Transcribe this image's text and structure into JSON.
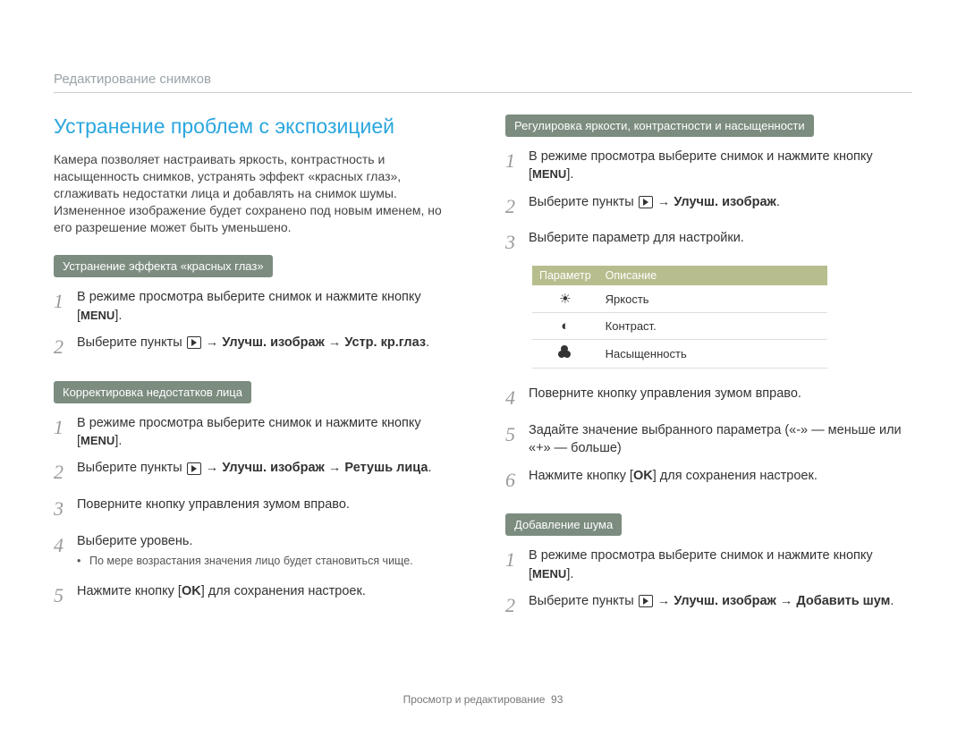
{
  "breadcrumb": "Редактирование снимков",
  "title": "Устранение проблем с экспозицией",
  "intro": "Камера позволяет настраивать яркость, контрастность и насыщенность снимков, устранять эффект «красных глаз», сглаживать недостатки лица и добавлять на снимок шумы. Измененное изображение будет сохранено под новым именем, но его разрешение может быть уменьшено.",
  "sections": {
    "redeye": {
      "badge": "Устранение эффекта «красных глаз»",
      "step1_prefix": "В режиме просмотра выберите снимок и нажмите кнопку [",
      "step1_btn": "MENU",
      "step1_suffix": "].",
      "step2_prefix": "Выберите пункты ",
      "step2_arrow1": " → ",
      "step2_opt1": "Улучш. изображ",
      "step2_arrow2": " → ",
      "step2_opt2": "Устр. кр.глаз",
      "step2_suffix": "."
    },
    "face": {
      "badge": "Корректировка недостатков лица",
      "step1_prefix": "В режиме просмотра выберите снимок и нажмите кнопку [",
      "step1_btn": "MENU",
      "step1_suffix": "].",
      "step2_prefix": "Выберите пункты ",
      "step2_opt1": "Улучш. изображ",
      "step2_opt2": "Ретушь лица",
      "step3": "Поверните кнопку управления зумом вправо.",
      "step4": "Выберите уровень.",
      "step4_bullet": "По мере возрастания значения лицо будет становиться чище.",
      "step5_prefix": "Нажмите кнопку [",
      "step5_btn": "OK",
      "step5_suffix": "] для сохранения настроек."
    },
    "adjust": {
      "badge": "Регулировка яркости, контрастности и насыщенности",
      "step1_prefix": "В режиме просмотра выберите снимок и нажмите кнопку [",
      "step1_btn": "MENU",
      "step1_suffix": "].",
      "step2_prefix": "Выберите пункты ",
      "step2_opt1": "Улучш. изображ",
      "step3": "Выберите параметр для настройки.",
      "table": {
        "h1": "Параметр",
        "h2": "Описание",
        "r1": "Яркость",
        "r2": "Контраст.",
        "r3": "Насыщенность"
      },
      "step4": "Поверните кнопку управления зумом вправо.",
      "step5": "Задайте значение выбранного параметра («-» — меньше или «+» — больше)",
      "step6_prefix": "Нажмите кнопку [",
      "step6_btn": "OK",
      "step6_suffix": "] для сохранения настроек."
    },
    "noise": {
      "badge": "Добавление шума",
      "step1_prefix": "В режиме просмотра выберите снимок и нажмите кнопку [",
      "step1_btn": "MENU",
      "step1_suffix": "].",
      "step2_prefix": "Выберите пункты ",
      "step2_opt1": "Улучш. изображ",
      "step2_opt2": "Добавить шум"
    }
  },
  "footer_text": "Просмотр и редактирование",
  "footer_page": "93"
}
